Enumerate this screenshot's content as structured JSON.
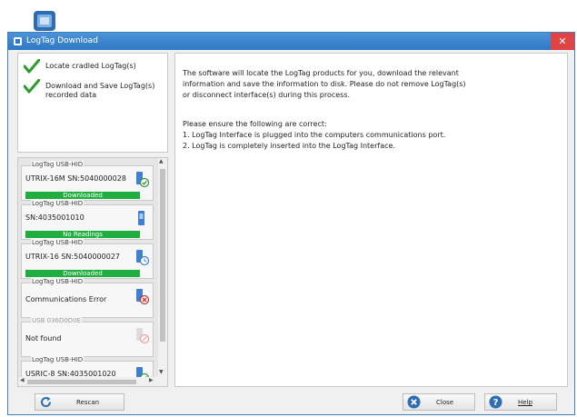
{
  "desktop": {
    "app_icon": "logtag-app-icon"
  },
  "window": {
    "title": "LogTag Download",
    "title_icon": "logtag-icon",
    "close_glyph": "✕"
  },
  "steps": [
    {
      "icon": "checkmark-icon",
      "label": "Locate cradled LogTag(s)"
    },
    {
      "icon": "checkmark-icon",
      "label": "Download and Save LogTag(s) recorded data"
    }
  ],
  "devices": [
    {
      "header": "LogTag USB-HID",
      "serial": "UTRIX-16M SN:5040000028",
      "status": "Downloaded",
      "icon": "logtag-ok-icon"
    },
    {
      "header": "LogTag USB-HID",
      "serial": "SN:4035001010",
      "status": "No Readings",
      "icon": "logtag-device-icon"
    },
    {
      "header": "LogTag USB-HID",
      "serial": "UTRIX-16 SN:5040000027",
      "status": "Downloaded",
      "icon": "logtag-clock-icon"
    },
    {
      "header": "LogTag USB-HID",
      "serial": "Communications Error",
      "status": "",
      "icon": "logtag-error-icon"
    },
    {
      "header": "USB 036D0D0E",
      "serial": "Not found",
      "status": "",
      "icon": "not-found-icon"
    },
    {
      "header": "LogTag USB-HID",
      "serial": "USRIC-8 SN:4035001020",
      "status": "",
      "icon": "logtag-ok-icon"
    }
  ],
  "main": {
    "lines": [
      "The software will locate the LogTag products for you, download the relevant",
      "information and save the information to disk. Please do not remove LogTag(s)",
      "or disconnect interface(s) during this process.",
      "Please ensure the following are correct:",
      "1. LogTag Interface is plugged into the computers communications port.",
      "2. LogTag is completely inserted into the LogTag Interface."
    ]
  },
  "buttons": {
    "rescan": "Rescan",
    "close": "Close",
    "help": "Help"
  },
  "colors": {
    "title_bar": "#2e78c6",
    "close_button": "#e04343",
    "status_green": "#1fae3f",
    "check_green": "#2c9a2c"
  }
}
